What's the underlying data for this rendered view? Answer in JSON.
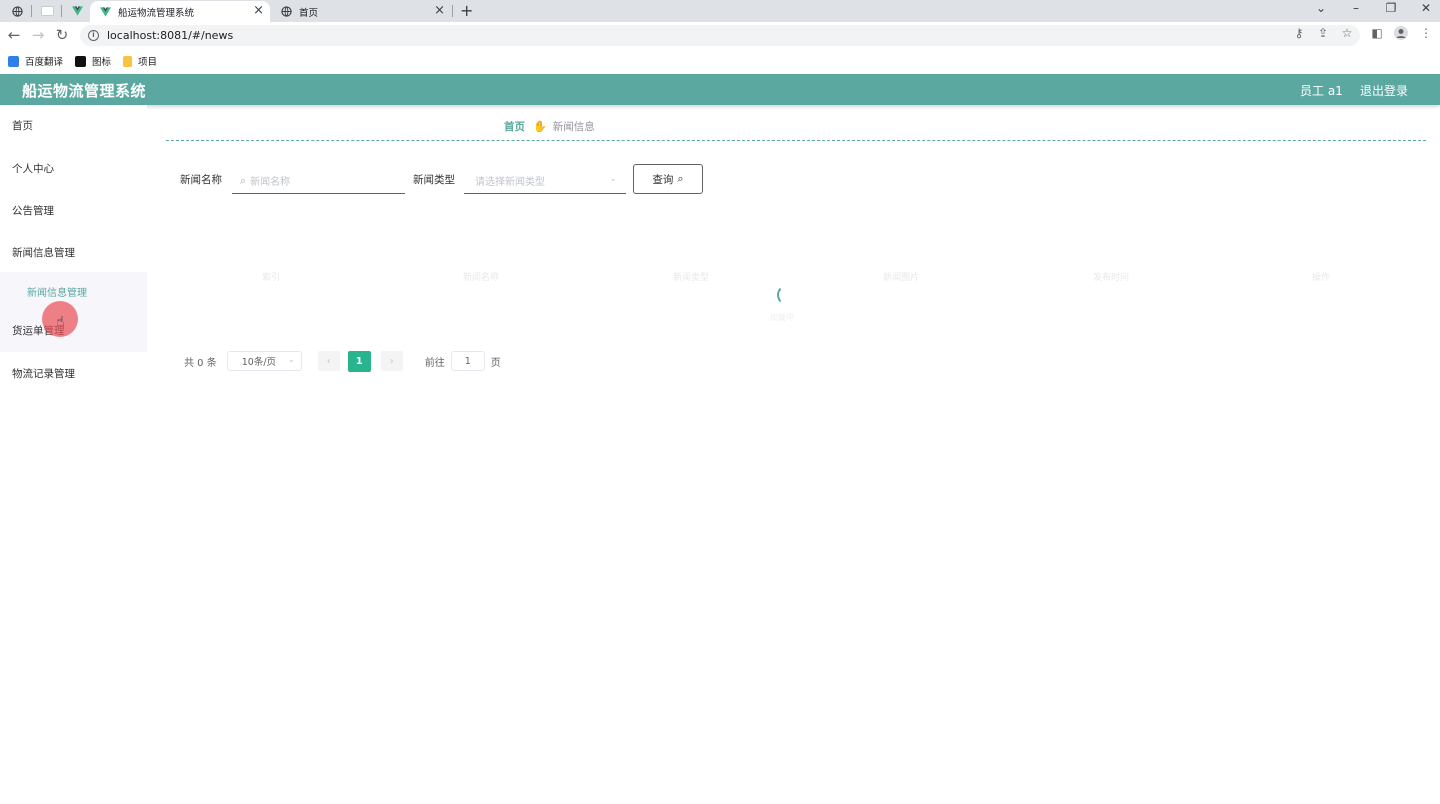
{
  "browser": {
    "tabs": [
      {
        "title": "船运物流管理系统",
        "active": true
      },
      {
        "title": "首页",
        "active": false
      }
    ],
    "url": "localhost:8081/#/news",
    "bookmarks": [
      {
        "label": "百度翻译",
        "color": "#2f7fe6"
      },
      {
        "label": "图标",
        "color": "#111111"
      },
      {
        "label": "项目",
        "color": "#f6c343"
      }
    ]
  },
  "header": {
    "title": "船运物流管理系统",
    "user": "员工 a1",
    "logout": "退出登录",
    "color": "#5ba8a0"
  },
  "sidebar": {
    "items": [
      {
        "label": "首页"
      },
      {
        "label": "个人中心"
      },
      {
        "label": "公告管理"
      },
      {
        "label": "新闻信息管理"
      },
      {
        "label": "货运单管理"
      },
      {
        "label": "物流记录管理"
      }
    ],
    "submenu": {
      "label": "新闻信息管理"
    }
  },
  "breadcrumb": {
    "home": "首页",
    "current": "新闻信息"
  },
  "search": {
    "name_label": "新闻名称",
    "name_placeholder": "新闻名称",
    "type_label": "新闻类型",
    "type_placeholder": "请选择新闻类型",
    "query_label": "查询"
  },
  "table": {
    "headers": [
      "索引",
      "新闻名称",
      "新闻类型",
      "新闻图片",
      "发布时间",
      "操作"
    ],
    "loading_text": "加载中"
  },
  "pagination": {
    "total_text": "共 0 条",
    "page_size": "10条/页",
    "current_page": "1",
    "goto_label": "前往",
    "goto_value": "1",
    "page_suffix": "页",
    "accent": "#28b48c"
  }
}
